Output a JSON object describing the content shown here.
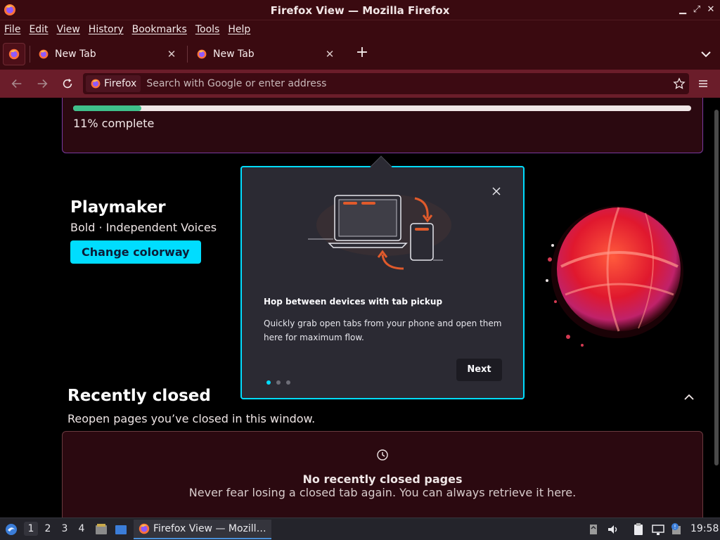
{
  "window": {
    "title": "Firefox View — Mozilla Firefox"
  },
  "menubar": {
    "items": [
      "File",
      "Edit",
      "View",
      "History",
      "Bookmarks",
      "Tools",
      "Help"
    ]
  },
  "tabs": [
    {
      "label": "New Tab"
    },
    {
      "label": "New Tab"
    }
  ],
  "urlbar": {
    "identity_label": "Firefox",
    "placeholder": "Search with Google or enter address"
  },
  "progress_card": {
    "text": "11% complete",
    "percent": 11
  },
  "colorway": {
    "name": "Playmaker",
    "subtitle": "Bold · Independent Voices",
    "button_label": "Change colorway"
  },
  "recently_closed": {
    "title": "Recently closed",
    "subtitle": "Reopen pages you’ve closed in this window.",
    "empty_title": "No recently closed pages",
    "empty_subtitle": "Never fear losing a closed tab again. You can always retrieve it here."
  },
  "popup": {
    "heading": "Hop between devices with tab pickup",
    "body": "Quickly grab open tabs from your phone and open them here for maximum flow.",
    "next_label": "Next",
    "steps_total": 3,
    "step_current": 1
  },
  "taskbar": {
    "workspaces": [
      "1",
      "2",
      "3",
      "4"
    ],
    "active_workspace": "1",
    "task_label": "Firefox View — Mozill…",
    "clock": "19:58"
  },
  "colors": {
    "frame": "#3a0a10",
    "toolbar": "#6b1d2a",
    "accent": "#00ddff",
    "progress": "#3fbf8a",
    "popup_bg": "#2b2a33"
  }
}
